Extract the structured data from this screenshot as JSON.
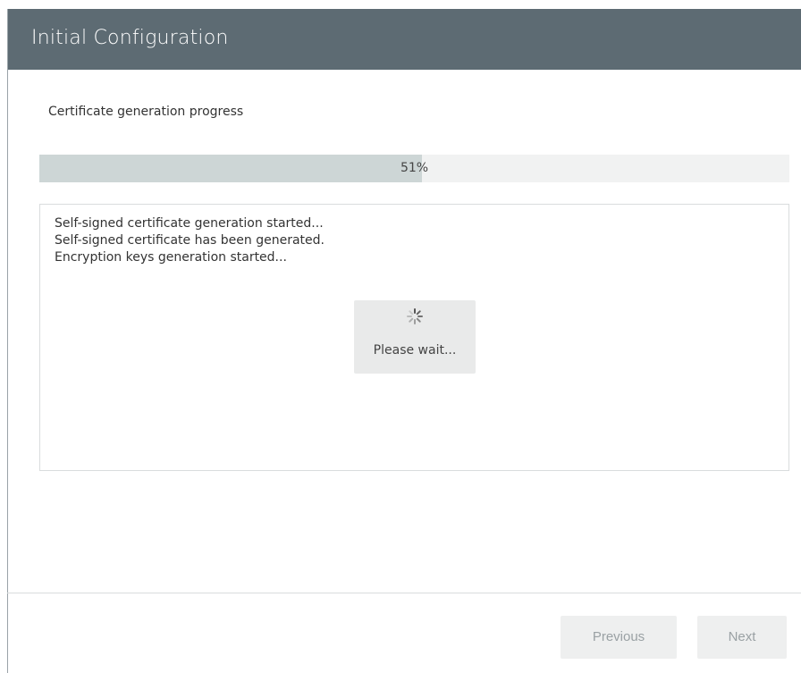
{
  "dialog": {
    "title": "Initial Configuration"
  },
  "progress": {
    "label": "Certificate generation progress",
    "percent": 51,
    "percent_text": "51%"
  },
  "log": {
    "lines": [
      "Self-signed certificate generation started...",
      "Self-signed certificate has been generated.",
      "Encryption keys generation started..."
    ]
  },
  "loading": {
    "icon": "spinner-icon",
    "text": "Please wait..."
  },
  "footer": {
    "previous_label": "Previous",
    "next_label": "Next"
  },
  "colors": {
    "titlebar": "#5d6b73",
    "progress_fill": "#cdd6d6",
    "progress_track": "#f1f2f2"
  }
}
